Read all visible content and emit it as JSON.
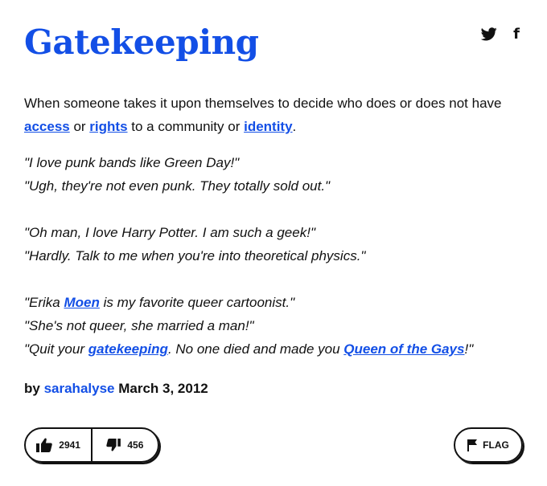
{
  "entry": {
    "word": "Gatekeeping",
    "meaning": {
      "text1": "When someone takes it upon themselves to decide who does or does not have ",
      "link1": "access",
      "text2": " or ",
      "link2": "rights",
      "text3": " to a community or ",
      "link3": "identity",
      "text4": "."
    },
    "example": {
      "l1": "\"I love punk bands like Green Day!\"",
      "l2": "\"Ugh, they're not even punk. They totally sold out.\"",
      "l3": "\"Oh man, I love Harry Potter. I am such a geek!\"",
      "l4": "\"Hardly. Talk to me when you're into theoretical physics.\"",
      "l5a": "\"Erika ",
      "l5link": "Moen",
      "l5b": " is my favorite queer cartoonist.\"",
      "l6": "\"She's not queer, she married a man!\"",
      "l7a": "\"Quit your ",
      "l7link1": "gatekeeping",
      "l7b": ". No one died and made you ",
      "l7link2": "Queen of the Gays",
      "l7c": "!\""
    },
    "byline": {
      "prefix": "by",
      "author": "sarahalyse",
      "date": "March 3, 2012"
    },
    "votes": {
      "up": "2941",
      "down": "456"
    },
    "flag_label": "FLAG"
  },
  "social": {
    "twitter_icon": "twitter-icon",
    "facebook_icon": "facebook-icon",
    "facebook_glyph": "f"
  },
  "colors": {
    "accent": "#134fe6",
    "text": "#111111"
  }
}
